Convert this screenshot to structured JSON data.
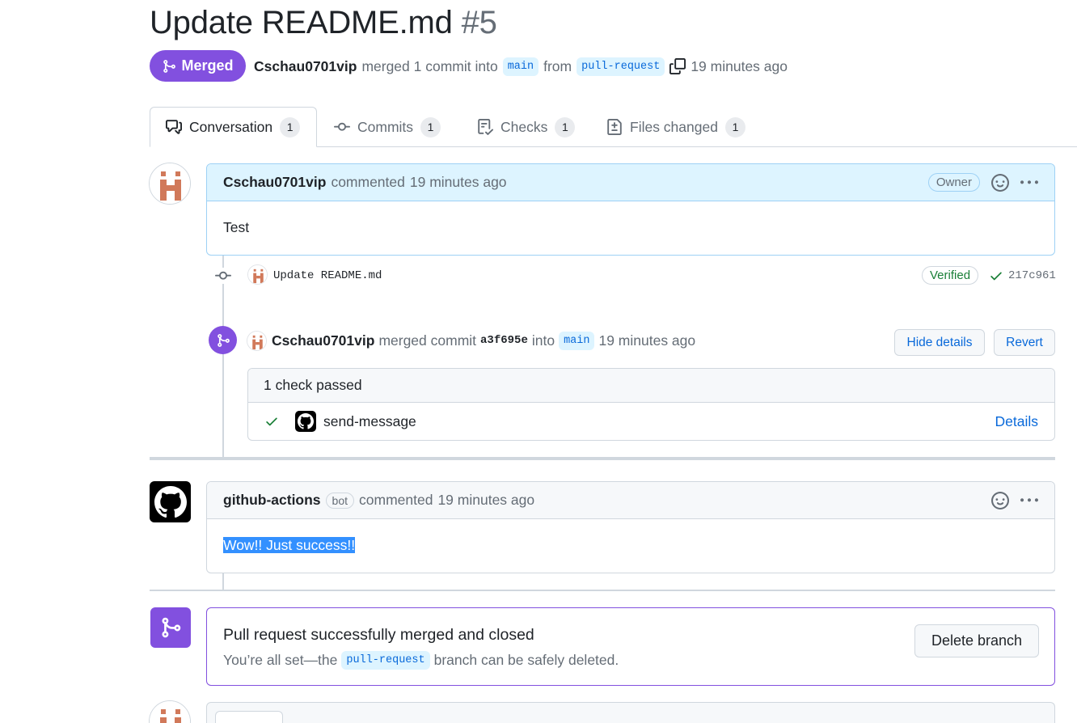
{
  "pr": {
    "title": "Update README.md",
    "number": "#5",
    "state": "Merged",
    "author": "Cschau0701vip",
    "merge_text": "merged 1 commit into",
    "base_branch": "main",
    "from_text": "from",
    "head_branch": "pull-request",
    "time": "19 minutes ago"
  },
  "tabs": [
    {
      "label": "Conversation",
      "count": "1"
    },
    {
      "label": "Commits",
      "count": "1"
    },
    {
      "label": "Checks",
      "count": "1"
    },
    {
      "label": "Files changed",
      "count": "1"
    }
  ],
  "comment1": {
    "author": "Cschau0701vip",
    "action": "commented",
    "time": "19 minutes ago",
    "badge": "Owner",
    "body": "Test"
  },
  "commit": {
    "message": "Update README.md",
    "verified": "Verified",
    "sha": "217c961"
  },
  "merge_event": {
    "author": "Cschau0701vip",
    "text": "merged commit",
    "sha": "a3f695e",
    "into": "into",
    "branch": "main",
    "time": "19 minutes ago",
    "hide_details": "Hide details",
    "revert": "Revert"
  },
  "checks": {
    "summary": "1 check passed",
    "name": "send-message",
    "details": "Details"
  },
  "comment2": {
    "author": "github-actions",
    "badge": "bot",
    "action": "commented",
    "time": "19 minutes ago",
    "body": "Wow!! Just success!!"
  },
  "merged_notice": {
    "title": "Pull request successfully merged and closed",
    "text_before": "You’re all set—the",
    "branch": "pull-request",
    "text_after": "branch can be safely deleted.",
    "delete_button": "Delete branch"
  },
  "colors": {
    "merged_purple": "#8250df",
    "link_blue": "#0969da",
    "success_green": "#1a7f37",
    "owner_header": "#ddf4ff"
  }
}
